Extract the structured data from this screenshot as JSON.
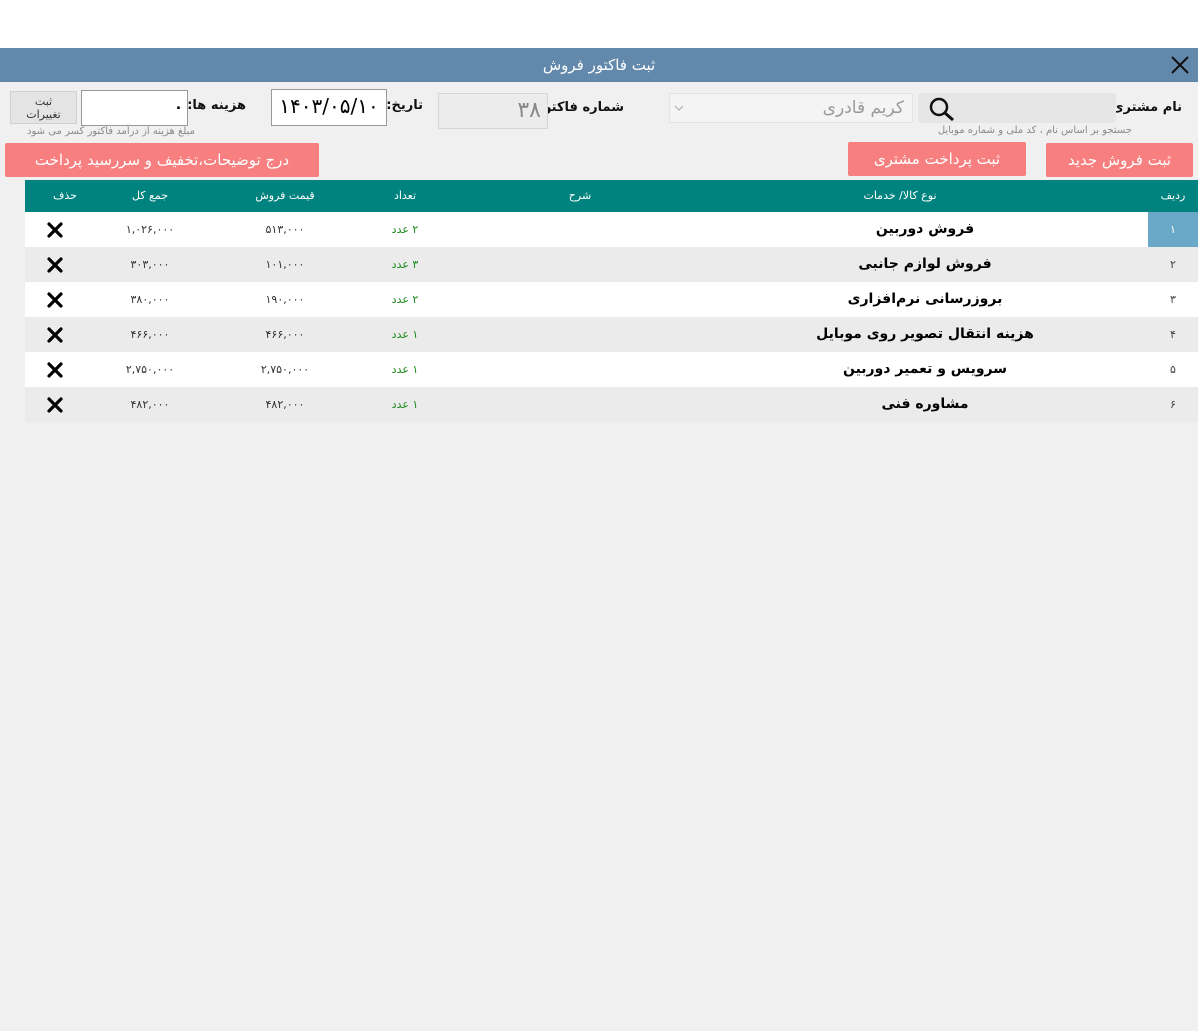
{
  "window": {
    "title": "ثبت فاکتور فروش"
  },
  "form": {
    "customer_label": "نام مشتری:",
    "customer_hint": "جستجو بر اساس نام ، کد ملی و شماره موبایل",
    "customer_value": "کریم قادری",
    "invoice_label": "شماره فاکتور:",
    "invoice_number": "۳۸",
    "date_label": "تاریخ:",
    "date_value": "۱۴۰۳/۰۵/۱۰",
    "cost_label": "هزینه ها:",
    "cost_value": "۰",
    "cost_hint": "مبلغ هزینه از درآمد فاکتور کسر می شود",
    "save_changes_line1": "ثبت",
    "save_changes_line2": "تغییرات"
  },
  "buttons": {
    "new_sale": "ثبت فروش جدید",
    "customer_payment": "ثبت پرداخت مشتری",
    "notes_discount": "درج توضیحات،تخفیف و سررسید پرداخت"
  },
  "table": {
    "headers": {
      "row": "ردیف",
      "item": "نوع کالا/ خدمات",
      "desc": "شرح",
      "qty": "تعداد",
      "price": "قیمت فروش",
      "total": "جمع کل",
      "delete": "حذف"
    },
    "rows": [
      {
        "no": "۱",
        "item": "فروش دوربین",
        "qty": "۲ عدد",
        "price": "۵۱۳,۰۰۰",
        "total": "۱,۰۲۶,۰۰۰"
      },
      {
        "no": "۲",
        "item": "فروش لوازم جانبی",
        "qty": "۳ عدد",
        "price": "۱۰۱,۰۰۰",
        "total": "۳۰۳,۰۰۰"
      },
      {
        "no": "۳",
        "item": "بروزرسانی نرم‌افزاری",
        "qty": "۲ عدد",
        "price": "۱۹۰,۰۰۰",
        "total": "۳۸۰,۰۰۰"
      },
      {
        "no": "۴",
        "item": "هزینه انتقال تصویر روی موبایل",
        "qty": "۱ عدد",
        "price": "۴۶۶,۰۰۰",
        "total": "۴۶۶,۰۰۰"
      },
      {
        "no": "۵",
        "item": "سرویس و تعمیر دوربین",
        "qty": "۱ عدد",
        "price": "۲,۷۵۰,۰۰۰",
        "total": "۲,۷۵۰,۰۰۰"
      },
      {
        "no": "۶",
        "item": "مشاوره فنی",
        "qty": "۱ عدد",
        "price": "۴۸۲,۰۰۰",
        "total": "۴۸۲,۰۰۰"
      }
    ]
  },
  "colors": {
    "titlebar": "#6289ab",
    "header": "#00837f",
    "button": "#f77f7f",
    "selected_row": "#6aa8c8",
    "qty_text": "#1a8a1a"
  },
  "icons": {
    "close": "close-icon",
    "search": "search-icon",
    "dropdown": "chevron-down-icon",
    "delete": "delete-x-icon"
  }
}
